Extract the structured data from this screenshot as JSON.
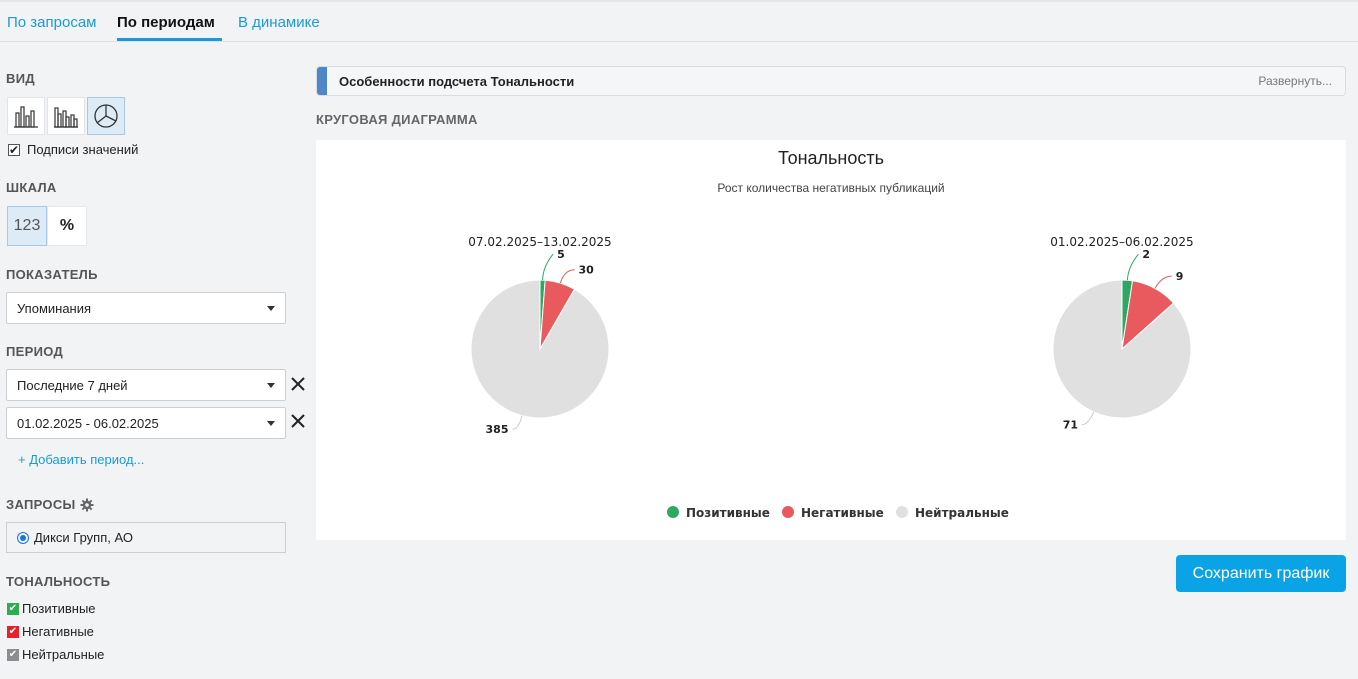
{
  "tabs": [
    {
      "label": "По запросам"
    },
    {
      "label": "По периодам"
    },
    {
      "label": "В динамике"
    }
  ],
  "sidebar": {
    "view": {
      "title": "ВИД",
      "buttons": [
        "bar-chart-icon",
        "grouped-bar-chart-icon",
        "pie-chart-icon"
      ],
      "selected": "pie-chart-icon",
      "value_labels_checkbox": {
        "label": "Подписи значений",
        "checked": true
      }
    },
    "scale": {
      "title": "ШКАЛА",
      "options": [
        "123",
        "%"
      ],
      "selected": "123"
    },
    "indicator": {
      "title": "ПОКАЗАТЕЛЬ",
      "value": "Упоминания"
    },
    "period": {
      "title": "ПЕРИОД",
      "selects": [
        "Последние 7 дней",
        "01.02.2025 - 06.02.2025"
      ],
      "add_link": "+ Добавить период..."
    },
    "queries": {
      "title": "ЗАПРОСЫ",
      "selected": "Дикси Групп, АО"
    },
    "tonality": {
      "title": "ТОНАЛЬНОСТЬ",
      "items": [
        {
          "label": "Позитивные",
          "checked": true,
          "color": "#2fab52"
        },
        {
          "label": "Негативные",
          "checked": true,
          "color": "#e8202b"
        },
        {
          "label": "Нейтральные",
          "checked": true,
          "color": "#8a8d91"
        }
      ]
    }
  },
  "infobar": {
    "title": "Особенности подсчета Тональности",
    "expand": "Развернуть..."
  },
  "chart_type_label": "КРУГОВАЯ ДИАГРАММА",
  "chart_data": {
    "type": "pie",
    "title": "Тональность",
    "subtitle": "Рост количества негативных публикаций",
    "categories": [
      "Позитивные",
      "Негативные",
      "Нейтральные"
    ],
    "colors": [
      "#2ca862",
      "#e85a5d",
      "#e0e0e0"
    ],
    "series": [
      {
        "name": "07.02.2025–13.02.2025",
        "values": [
          5,
          30,
          385
        ]
      },
      {
        "name": "01.02.2025–06.02.2025",
        "values": [
          2,
          9,
          71
        ]
      }
    ],
    "legend": "bottom-center"
  },
  "save_button": "Сохранить график"
}
